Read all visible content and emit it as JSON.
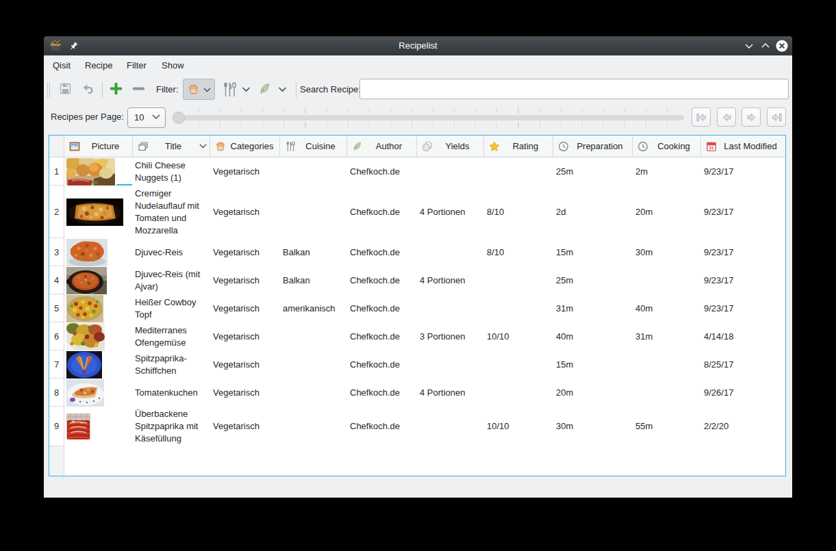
{
  "window": {
    "title": "Recipelist",
    "accent_color": "#3daee9",
    "titlebar_color": "#31363b"
  },
  "menubar": {
    "items": [
      {
        "label": "Qisit"
      },
      {
        "label": "Recipe"
      },
      {
        "label": "Filter"
      },
      {
        "label": "Show"
      }
    ]
  },
  "toolbar": {
    "filter_label": "Filter:",
    "search_label": "Search Recipe:",
    "search_value": "",
    "buttons": [
      {
        "name": "save",
        "icon": "floppy-icon",
        "enabled": false
      },
      {
        "name": "undo",
        "icon": "undo-arrow-icon",
        "enabled": false
      },
      {
        "name": "add-recipe",
        "icon": "plus-icon",
        "color": "#36a436",
        "enabled": true
      },
      {
        "name": "remove-recipe",
        "icon": "minus-icon",
        "enabled": false
      }
    ],
    "filter_dropdowns": [
      {
        "name": "categories-filter",
        "icon": "bread-icon",
        "checked": true
      },
      {
        "name": "cuisine-filter",
        "icon": "cutlery-icon",
        "checked": false
      },
      {
        "name": "author-filter",
        "icon": "feather-icon",
        "checked": false
      }
    ]
  },
  "pagination": {
    "label": "Recipes per Page:",
    "value": "10",
    "nav_buttons": [
      "first-page",
      "previous-page",
      "next-page",
      "last-page"
    ]
  },
  "table": {
    "columns": [
      {
        "label": "Picture",
        "icon": "picture-icon"
      },
      {
        "label": "Title",
        "icon": "copies-icon",
        "sorted": "desc"
      },
      {
        "label": "Categories",
        "icon": "bread-icon"
      },
      {
        "label": "Cuisine",
        "icon": "cutlery-icon"
      },
      {
        "label": "Author",
        "icon": "feather-icon"
      },
      {
        "label": "Yields",
        "icon": "plates-icon"
      },
      {
        "label": "Rating",
        "icon": "star-icon"
      },
      {
        "label": "Preparation",
        "icon": "clock-icon"
      },
      {
        "label": "Cooking",
        "icon": "clock-icon"
      },
      {
        "label": "Last Modified",
        "icon": "calendar-icon"
      }
    ],
    "rows": [
      {
        "num": "1",
        "thumb": "thumb-chili-cheese-nuggets",
        "title": "Chili Cheese Nuggets (1)",
        "categories": "Vegetarisch",
        "cuisine": "",
        "author": "Chefkoch.de",
        "yields": "",
        "rating": "",
        "preparation": "25m",
        "cooking": "2m",
        "last_modified": "9/23/17"
      },
      {
        "num": "2",
        "thumb": "thumb-nudelauflauf",
        "title": "Cremiger Nudelauflauf mit Tomaten und Mozzarella",
        "categories": "Vegetarisch",
        "cuisine": "",
        "author": "Chefkoch.de",
        "yields": "4 Portionen",
        "rating": "8/10",
        "preparation": "2d",
        "cooking": "20m",
        "last_modified": "9/23/17"
      },
      {
        "num": "3",
        "thumb": "thumb-djuvec-reis",
        "title": "Djuvec-Reis",
        "categories": "Vegetarisch",
        "cuisine": "Balkan",
        "author": "Chefkoch.de",
        "yields": "",
        "rating": "8/10",
        "preparation": "15m",
        "cooking": "30m",
        "last_modified": "9/23/17"
      },
      {
        "num": "4",
        "thumb": "thumb-djuvec-reis-ajvar",
        "title": "Djuvec-Reis (mit Ajvar)",
        "categories": "Vegetarisch",
        "cuisine": "Balkan",
        "author": "Chefkoch.de",
        "yields": "4 Portionen",
        "rating": "",
        "preparation": "25m",
        "cooking": "",
        "last_modified": "9/23/17"
      },
      {
        "num": "5",
        "thumb": "thumb-cowboy-topf",
        "title": "Heißer Cowboy Topf",
        "categories": "Vegetarisch",
        "cuisine": "amerikanisch",
        "author": "Chefkoch.de",
        "yields": "",
        "rating": "",
        "preparation": "31m",
        "cooking": "40m",
        "last_modified": "9/23/17"
      },
      {
        "num": "6",
        "thumb": "thumb-ofengemuese",
        "title": "Mediterranes Ofengemüse",
        "categories": "Vegetarisch",
        "cuisine": "",
        "author": "Chefkoch.de",
        "yields": "3 Portionen",
        "rating": "10/10",
        "preparation": "40m",
        "cooking": "31m",
        "last_modified": "4/14/18"
      },
      {
        "num": "7",
        "thumb": "thumb-spitzpaprika-schiffchen",
        "title": "Spitzpaprika-Schiffchen",
        "categories": "Vegetarisch",
        "cuisine": "",
        "author": "Chefkoch.de",
        "yields": "",
        "rating": "",
        "preparation": "15m",
        "cooking": "",
        "last_modified": "8/25/17"
      },
      {
        "num": "8",
        "thumb": "thumb-tomatenkuchen",
        "title": "Tomatenkuchen",
        "categories": "Vegetarisch",
        "cuisine": "",
        "author": "Chefkoch.de",
        "yields": "4 Portionen",
        "rating": "",
        "preparation": "20m",
        "cooking": "",
        "last_modified": "9/26/17"
      },
      {
        "num": "9",
        "thumb": "thumb-ueberbackene-spitzpaprika",
        "title": "Überbackene Spitzpaprika mit Käsefüllung",
        "categories": "Vegetarisch",
        "cuisine": "",
        "author": "Chefkoch.de",
        "yields": "",
        "rating": "10/10",
        "preparation": "30m",
        "cooking": "55m",
        "last_modified": "2/2/20"
      }
    ]
  }
}
